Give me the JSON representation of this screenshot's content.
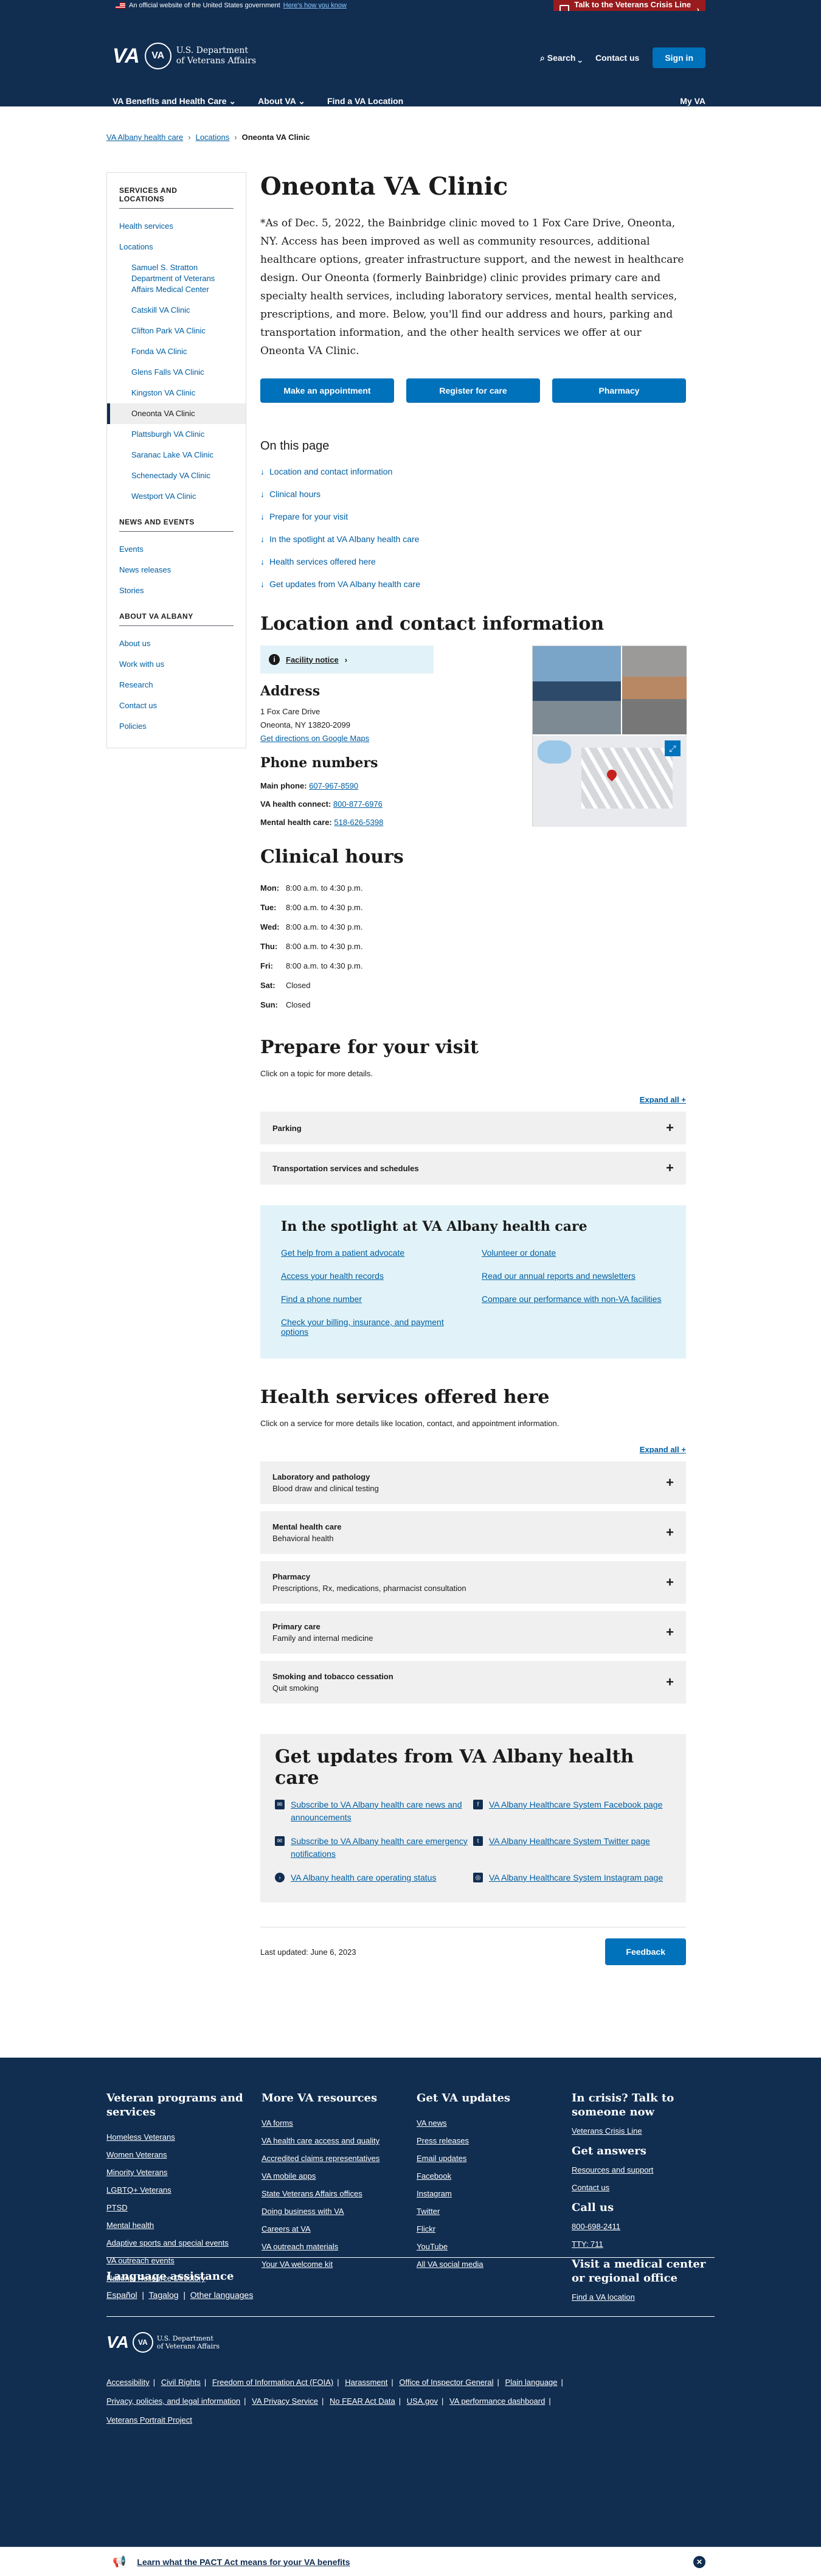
{
  "banner": {
    "text": "An official website of the United States government",
    "link": "Here's how you know",
    "crisis": "Talk to the Veterans Crisis Line now"
  },
  "header": {
    "logo": "VA",
    "seal": "VA",
    "dept_line1": "U.S. Department",
    "dept_line2": "of Veterans Affairs",
    "search": "Search",
    "contact": "Contact us",
    "signin": "Sign in",
    "nav": [
      "VA Benefits and Health Care",
      "About VA",
      "Find a VA Location"
    ],
    "myva": "My VA"
  },
  "breadcrumb": [
    "VA Albany health care",
    "Locations",
    "Oneonta VA Clinic"
  ],
  "sidebar": {
    "section1": "SERVICES AND LOCATIONS",
    "health": "Health services",
    "locations": "Locations",
    "facilities": [
      "Samuel S. Stratton Department of Veterans Affairs Medical Center",
      "Catskill VA Clinic",
      "Clifton Park VA Clinic",
      "Fonda VA Clinic",
      "Glens Falls VA Clinic",
      "Kingston VA Clinic",
      "Oneonta VA Clinic",
      "Plattsburgh VA Clinic",
      "Saranac Lake VA Clinic",
      "Schenectady VA Clinic",
      "Westport VA Clinic"
    ],
    "section2": "NEWS AND EVENTS",
    "news": [
      "Events",
      "News releases",
      "Stories"
    ],
    "section3": "ABOUT VA ALBANY",
    "about": [
      "About us",
      "Work with us",
      "Research",
      "Contact us",
      "Policies"
    ]
  },
  "main": {
    "title": "Oneonta VA Clinic",
    "intro": "*As of Dec. 5, 2022, the Bainbridge clinic moved to 1 Fox Care Drive, Oneonta, NY. Access has been improved as well as community resources, additional healthcare options, greater infrastructure support, and the newest in healthcare design. Our Oneonta (formerly Bainbridge) clinic provides primary care and specialty health services, including laboratory services, mental health services, prescriptions, and more. Below, you'll find our address and hours, parking and transportation information, and the other health services we offer at our Oneonta VA Clinic.",
    "buttons": [
      "Make an appointment",
      "Register for care",
      "Pharmacy"
    ],
    "toc_title": "On this page",
    "toc": [
      "Location and contact information",
      "Clinical hours",
      "Prepare for your visit",
      "In the spotlight at VA Albany health care",
      "Health services offered here",
      "Get updates from VA Albany health care"
    ]
  },
  "location": {
    "heading": "Location and contact information",
    "notice": "Facility notice",
    "address_heading": "Address",
    "address1": "1 Fox Care Drive",
    "address2": "Oneonta, NY 13820-2099",
    "directions": "Get directions on Google Maps",
    "phones_heading": "Phone numbers",
    "phones": [
      {
        "label": "Main phone:",
        "value": "607-967-8590"
      },
      {
        "label": "VA health connect:",
        "value": "800-877-6976"
      },
      {
        "label": "Mental health care:",
        "value": "518-626-5398"
      }
    ]
  },
  "hours": {
    "heading": "Clinical hours",
    "rows": [
      {
        "day": "Mon:",
        "time": "8:00 a.m. to 4:30 p.m."
      },
      {
        "day": "Tue:",
        "time": "8:00 a.m. to 4:30 p.m."
      },
      {
        "day": "Wed:",
        "time": "8:00 a.m. to 4:30 p.m."
      },
      {
        "day": "Thu:",
        "time": "8:00 a.m. to 4:30 p.m."
      },
      {
        "day": "Fri:",
        "time": "8:00 a.m. to 4:30 p.m."
      },
      {
        "day": "Sat:",
        "time": "Closed"
      },
      {
        "day": "Sun:",
        "time": "Closed"
      }
    ]
  },
  "prepare": {
    "heading": "Prepare for your visit",
    "sub": "Click on a topic for more details.",
    "expand": "Expand all +",
    "items": [
      "Parking",
      "Transportation services and schedules"
    ]
  },
  "spotlight": {
    "heading": "In the spotlight at VA Albany health care",
    "links": [
      "Get help from a patient advocate",
      "Volunteer or donate",
      "Access your health records",
      "Read our annual reports and newsletters",
      "Find a phone number",
      "Compare our performance with non-VA facilities",
      "Check your billing, insurance, and payment options"
    ]
  },
  "services": {
    "heading": "Health services offered here",
    "sub": "Click on a service for more details like location, contact, and appointment information.",
    "expand": "Expand all +",
    "items": [
      {
        "title": "Laboratory and pathology",
        "desc": "Blood draw and clinical testing"
      },
      {
        "title": "Mental health care",
        "desc": "Behavioral health"
      },
      {
        "title": "Pharmacy",
        "desc": "Prescriptions, Rx, medications, pharmacist consultation"
      },
      {
        "title": "Primary care",
        "desc": "Family and internal medicine"
      },
      {
        "title": "Smoking and tobacco cessation",
        "desc": "Quit smoking"
      }
    ]
  },
  "updates": {
    "heading": "Get updates from VA Albany health care",
    "links": [
      "Subscribe to VA Albany health care news and announcements",
      "VA Albany Healthcare System Facebook page",
      "Subscribe to VA Albany health care emergency notifications",
      "VA Albany Healthcare System Twitter page",
      "VA Albany health care operating status",
      "VA Albany Healthcare System Instagram page"
    ]
  },
  "last_updated": "Last updated: June 6, 2023",
  "feedback": "Feedback",
  "footer": {
    "col1_title": "Veteran programs and services",
    "col1": [
      "Homeless Veterans",
      "Women Veterans",
      "Minority Veterans",
      "LGBTQ+ Veterans",
      "PTSD",
      "Mental health",
      "Adaptive sports and special events",
      "VA outreach events",
      "National Resource Directory"
    ],
    "col2_title": "More VA resources",
    "col2": [
      "VA forms",
      "VA health care access and quality",
      "Accredited claims representatives",
      "VA mobile apps",
      "State Veterans Affairs offices",
      "Doing business with VA",
      "Careers at VA",
      "VA outreach materials",
      "Your VA welcome kit"
    ],
    "col3_title": "Get VA updates",
    "col3": [
      "VA news",
      "Press releases",
      "Email updates",
      "Facebook",
      "Instagram",
      "Twitter",
      "Flickr",
      "YouTube",
      "All VA social media"
    ],
    "col4_title1": "In crisis? Talk to someone now",
    "col4_link1": "Veterans Crisis Line",
    "col4_title2": "Get answers",
    "col4_links2": [
      "Resources and support",
      "Contact us"
    ],
    "col4_title3": "Call us",
    "col4_links3": [
      "800-698-2411",
      "TTY: 711"
    ],
    "col4_title4": "Visit a medical center or regional office",
    "col4_link4": "Find a VA location",
    "lang_title": "Language assistance",
    "langs": [
      "Español",
      "Tagalog",
      "Other languages"
    ],
    "links": [
      "Accessibility",
      "Civil Rights",
      "Freedom of Information Act (FOIA)",
      "Harassment",
      "Office of Inspector General",
      "Plain language",
      "Privacy, policies, and legal information",
      "VA Privacy Service",
      "No FEAR Act Data",
      "USA.gov",
      "VA performance dashboard",
      "Veterans Portrait Project"
    ]
  },
  "pact": "Learn what the PACT Act means for your VA benefits"
}
